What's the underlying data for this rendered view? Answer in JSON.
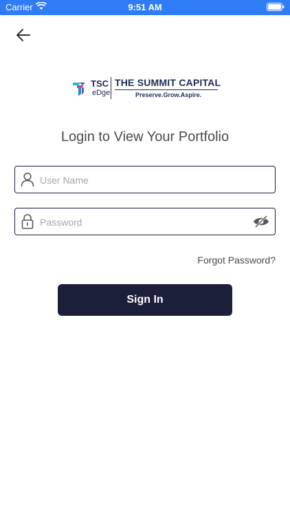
{
  "status_bar": {
    "carrier": "Carrier",
    "time": "9:51 AM"
  },
  "logo": {
    "short_name": "TSC",
    "sub_name": "eDge",
    "company_name": "THE SUMMIT CAPITAL",
    "tagline": "Preserve.Grow.Aspire."
  },
  "heading": "Login to View Your Portfolio",
  "form": {
    "username_placeholder": "User Name",
    "password_placeholder": "Password",
    "forgot_label": "Forgot Password?",
    "signin_label": "Sign In"
  },
  "icons": {
    "back": "arrow-left-icon",
    "user": "user-icon",
    "lock": "lock-icon",
    "eye": "eye-off-icon"
  },
  "colors": {
    "status_bar": "#2f7cf6",
    "primary": "#1c1f3a",
    "brand_navy": "#1f2a56",
    "placeholder": "#a6a6a6"
  }
}
